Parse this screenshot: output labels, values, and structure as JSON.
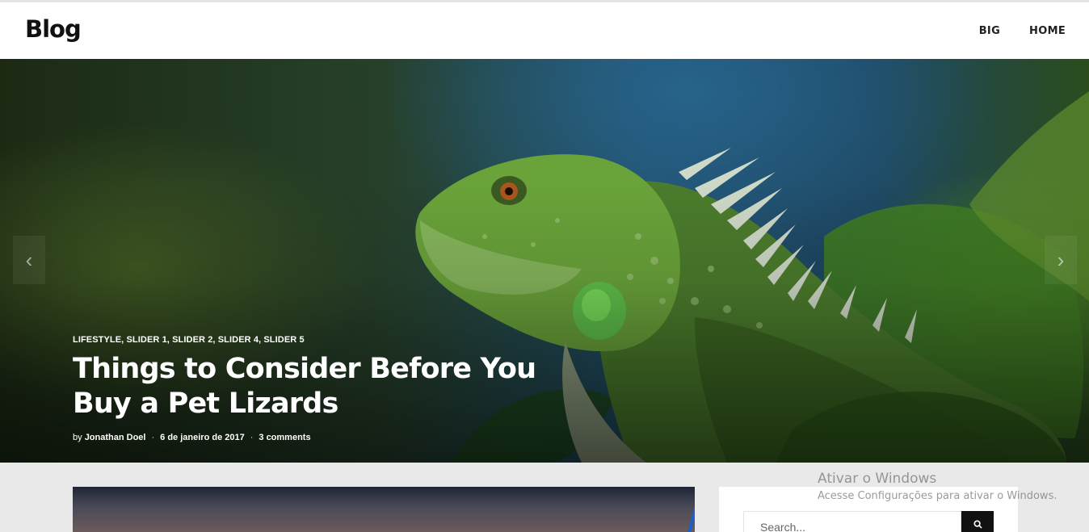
{
  "header": {
    "logo": "Blog",
    "nav": [
      "BIG",
      "HOME"
    ]
  },
  "hero": {
    "categories": "LIFESTYLE, SLIDER 1, SLIDER 2, SLIDER 4, SLIDER 5",
    "title": "Things to Consider Before You Buy a Pet Lizards",
    "meta": {
      "by": "by",
      "author": "Jonathan Doel",
      "date": "6 de janeiro de 2017",
      "comments": "3 comments"
    },
    "prev_icon": "chevron-left-icon",
    "next_icon": "chevron-right-icon"
  },
  "sidebar": {
    "search_placeholder": "Search...",
    "search_icon": "search-icon"
  },
  "watermark": {
    "title": "Ativar o Windows",
    "subtitle": "Acesse Configurações para ativar o Windows."
  },
  "colors": {
    "header_bg": "#ffffff",
    "page_bg": "#e9e9e9",
    "button_dark": "#111111"
  }
}
